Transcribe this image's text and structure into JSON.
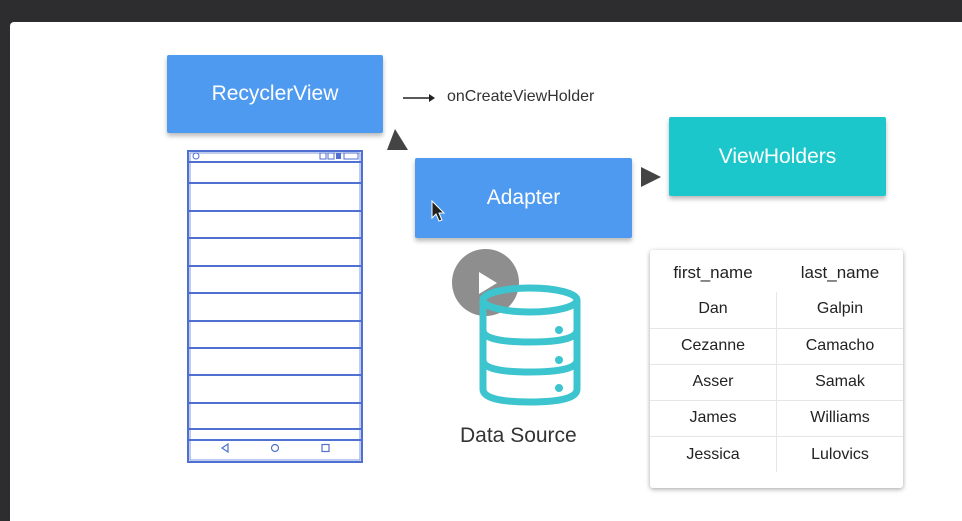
{
  "diagram": {
    "recyclerview_label": "RecyclerView",
    "adapter_label": "Adapter",
    "viewholders_label": "ViewHolders",
    "callback_label": "onCreateViewHolder",
    "data_source_label": "Data Source"
  },
  "colors": {
    "blue_box": "#4e9af0",
    "teal_box": "#1cc7cc",
    "phone_outline": "#4f6fd1",
    "db_icon": "#3cc4cf"
  },
  "table": {
    "headers": [
      "first_name",
      "last_name"
    ],
    "rows": [
      [
        "Dan",
        "Galpin"
      ],
      [
        "Cezanne",
        "Camacho"
      ],
      [
        "Asser",
        "Samak"
      ],
      [
        "James",
        "Williams"
      ],
      [
        "Jessica",
        "Lulovics"
      ]
    ]
  }
}
